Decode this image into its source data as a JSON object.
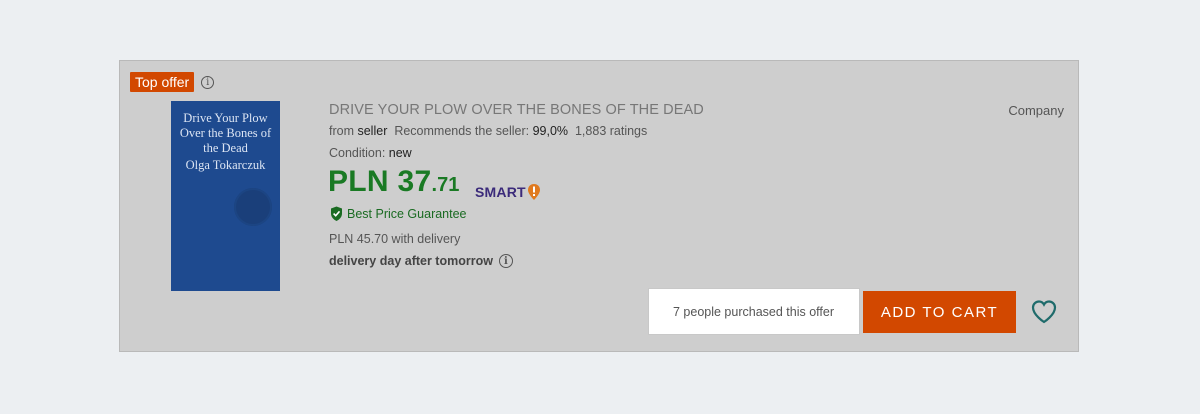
{
  "offer": {
    "badge": "Top offer",
    "title": "DRIVE YOUR PLOW OVER THE BONES OF THE DEAD",
    "company": "Company",
    "seller": {
      "from_label": "from",
      "name": "seller",
      "recommends_label": "Recommends the seller:",
      "recommends_value": "99,0%",
      "ratings": "1,883 ratings"
    },
    "condition": {
      "label": "Condition:",
      "value": "new"
    },
    "price": {
      "currency_main": "PLN 37",
      "cents": ".71"
    },
    "smart_label": "SMART",
    "guarantee": "Best Price Guarantee",
    "delivery_price": "PLN 45.70 with delivery",
    "delivery_day": "delivery day after tomorrow",
    "purchased": "7 people purchased this offer",
    "add_to_cart": "ADD TO CART"
  },
  "cover": {
    "title": "Drive Your Plow Over the Bones of the Dead",
    "author": "Olga Tokarczuk"
  },
  "colors": {
    "accent": "#d24800",
    "price_green": "#1a7a24",
    "smart_purple": "#3b2a7a",
    "heart_teal": "#1f6b6b",
    "cover_blue": "#1e4a8f"
  },
  "icons": {
    "info": "info-icon",
    "heart": "heart-icon",
    "guarantee": "shield-check-icon",
    "smart": "smart-badge-icon"
  }
}
